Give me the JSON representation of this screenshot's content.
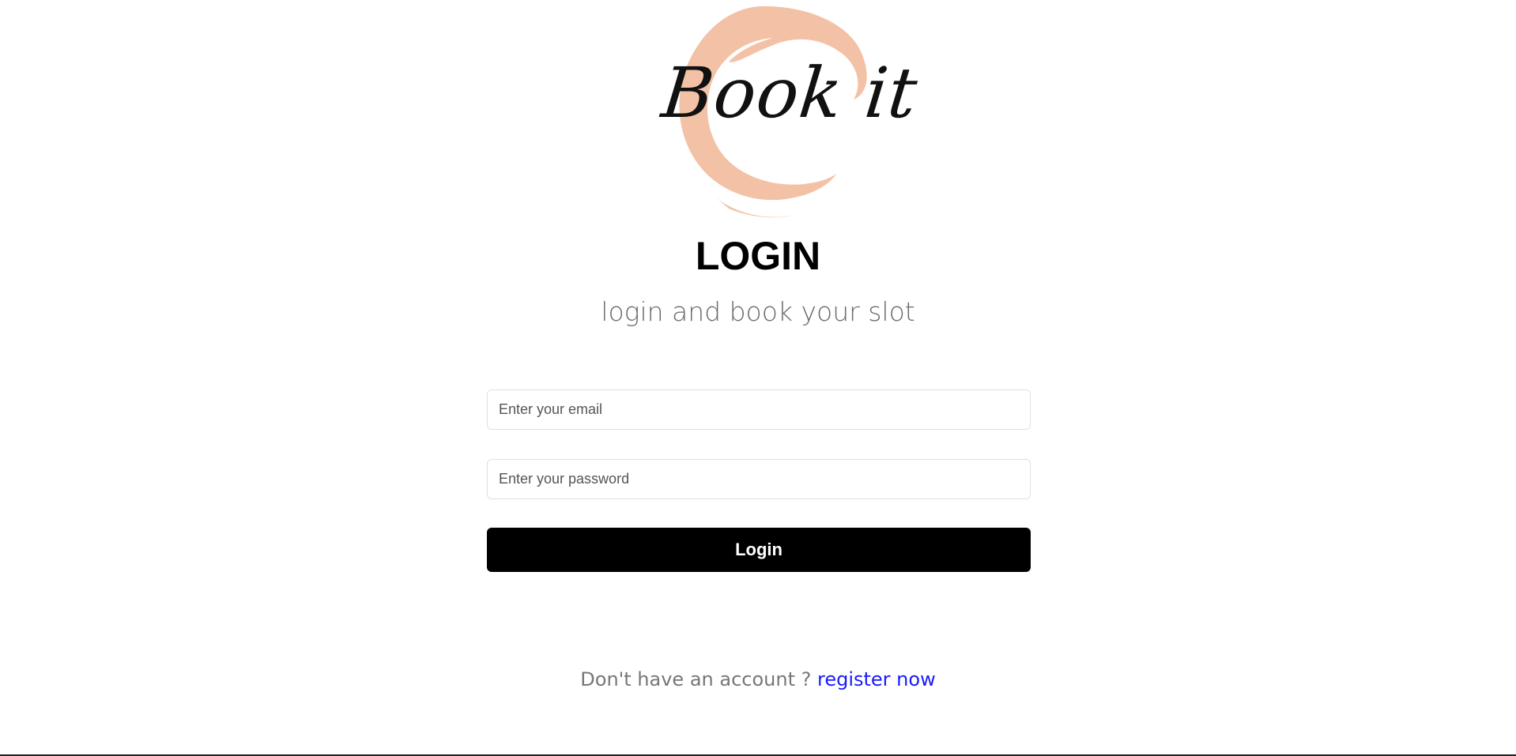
{
  "brand": {
    "logo_text": "Book it",
    "logo_color": "#f3c2a6"
  },
  "header": {
    "title": "LOGIN",
    "subtitle": "login and book your slot"
  },
  "form": {
    "email_placeholder": "Enter your email",
    "email_value": "",
    "password_placeholder": "Enter your password",
    "password_value": "",
    "submit_label": "Login"
  },
  "footer": {
    "prompt": "Don't have an account ? ",
    "register_link": "register now",
    "link_color": "#1a1aff"
  }
}
